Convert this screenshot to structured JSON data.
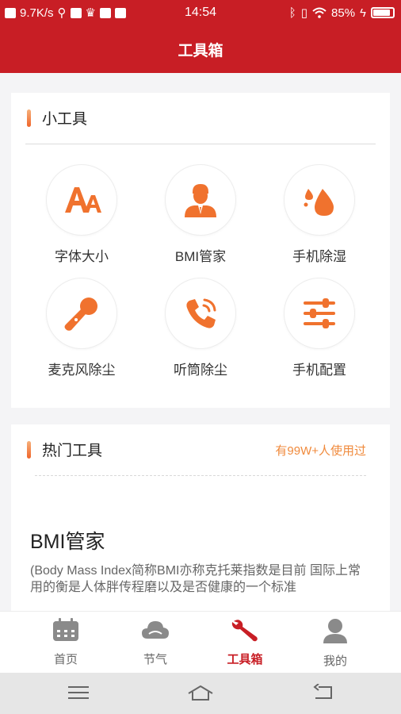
{
  "status": {
    "speed": "9.7K/s",
    "time": "14:54",
    "battery": "85%"
  },
  "header": {
    "title": "工具箱"
  },
  "tools_section": {
    "title": "小工具",
    "items": [
      {
        "label": "字体大小",
        "icon": "font-size-icon"
      },
      {
        "label": "BMI管家",
        "icon": "person-icon"
      },
      {
        "label": "手机除湿",
        "icon": "water-drops-icon"
      },
      {
        "label": "麦克风除尘",
        "icon": "microphone-icon"
      },
      {
        "label": "听筒除尘",
        "icon": "phone-icon"
      },
      {
        "label": "手机配置",
        "icon": "sliders-icon"
      }
    ]
  },
  "hot_section": {
    "title": "热门工具",
    "usage": "有99W+人使用过",
    "item_name": "BMI管家",
    "item_desc": "(Body Mass Index简称BMI亦称克托莱指数是目前 国际上常用的衡是人体胖传程磨以及是否健康的一个标准"
  },
  "tabbar": {
    "tabs": [
      {
        "label": "首页",
        "icon": "calendar-icon"
      },
      {
        "label": "节气",
        "icon": "cloud-icon"
      },
      {
        "label": "工具箱",
        "icon": "wrench-icon",
        "active": true
      },
      {
        "label": "我的",
        "icon": "user-icon"
      }
    ]
  },
  "colors": {
    "brand_red": "#c81e25",
    "accent_orange": "#f0722e",
    "tab_inactive": "#8a8a8a"
  }
}
